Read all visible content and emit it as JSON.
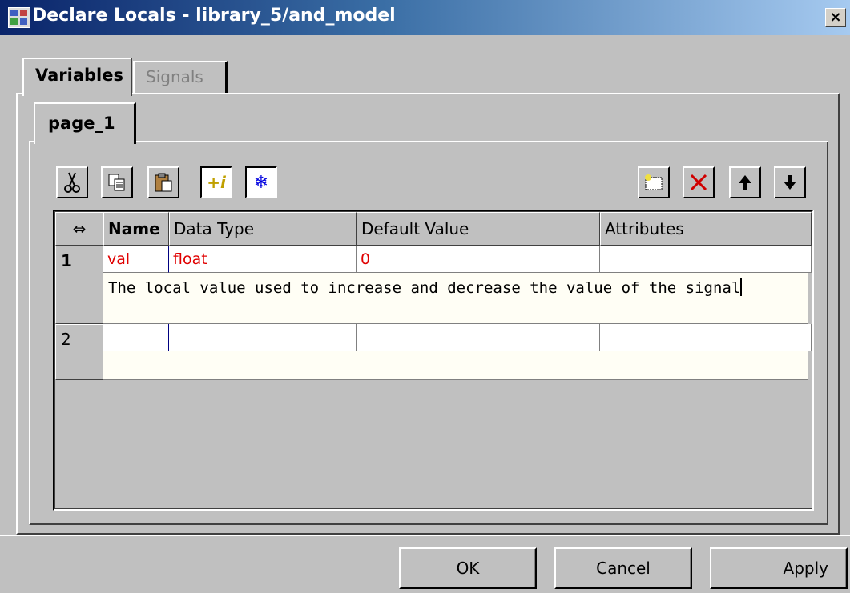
{
  "window": {
    "title": "Declare Locals - library_5/and_model",
    "close_glyph": "×"
  },
  "tabs": [
    {
      "label": "Variables",
      "active": true
    },
    {
      "label": "Signals",
      "active": false
    }
  ],
  "inner_tabs": [
    {
      "label": "page_1"
    }
  ],
  "toolbar": {
    "left": [
      {
        "icon": "cut-icon",
        "glyph": "✂"
      },
      {
        "icon": "copy-icon",
        "glyph": "⎘"
      },
      {
        "icon": "paste-icon",
        "glyph": "📋"
      },
      {
        "icon": "show-info-icon",
        "glyph": "+i",
        "active": true
      },
      {
        "icon": "freeze-icon",
        "glyph": "❄",
        "active": true
      }
    ],
    "right": [
      {
        "icon": "new-row-icon",
        "glyph": "□"
      },
      {
        "icon": "delete-icon",
        "glyph": "✕"
      },
      {
        "icon": "move-up-icon",
        "glyph": "🡅"
      },
      {
        "icon": "move-down-icon",
        "glyph": "🡇"
      }
    ]
  },
  "table": {
    "resize_glyph": "⇔",
    "columns": [
      "Name",
      "Data Type",
      "Default Value",
      "Attributes"
    ],
    "rows": [
      {
        "index": "1",
        "name": "val",
        "data_type": "float",
        "default_value": "0",
        "attributes": "",
        "description": "The local value used to increase and decrease the value of the signal"
      },
      {
        "index": "2",
        "name": "",
        "data_type": "",
        "default_value": "",
        "attributes": "",
        "description": ""
      }
    ]
  },
  "buttons": {
    "ok": "OK",
    "cancel": "Cancel",
    "apply": "Apply"
  },
  "colors": {
    "value_text": "#e00000",
    "title_start": "#0a246a",
    "title_end": "#a6caf0"
  }
}
